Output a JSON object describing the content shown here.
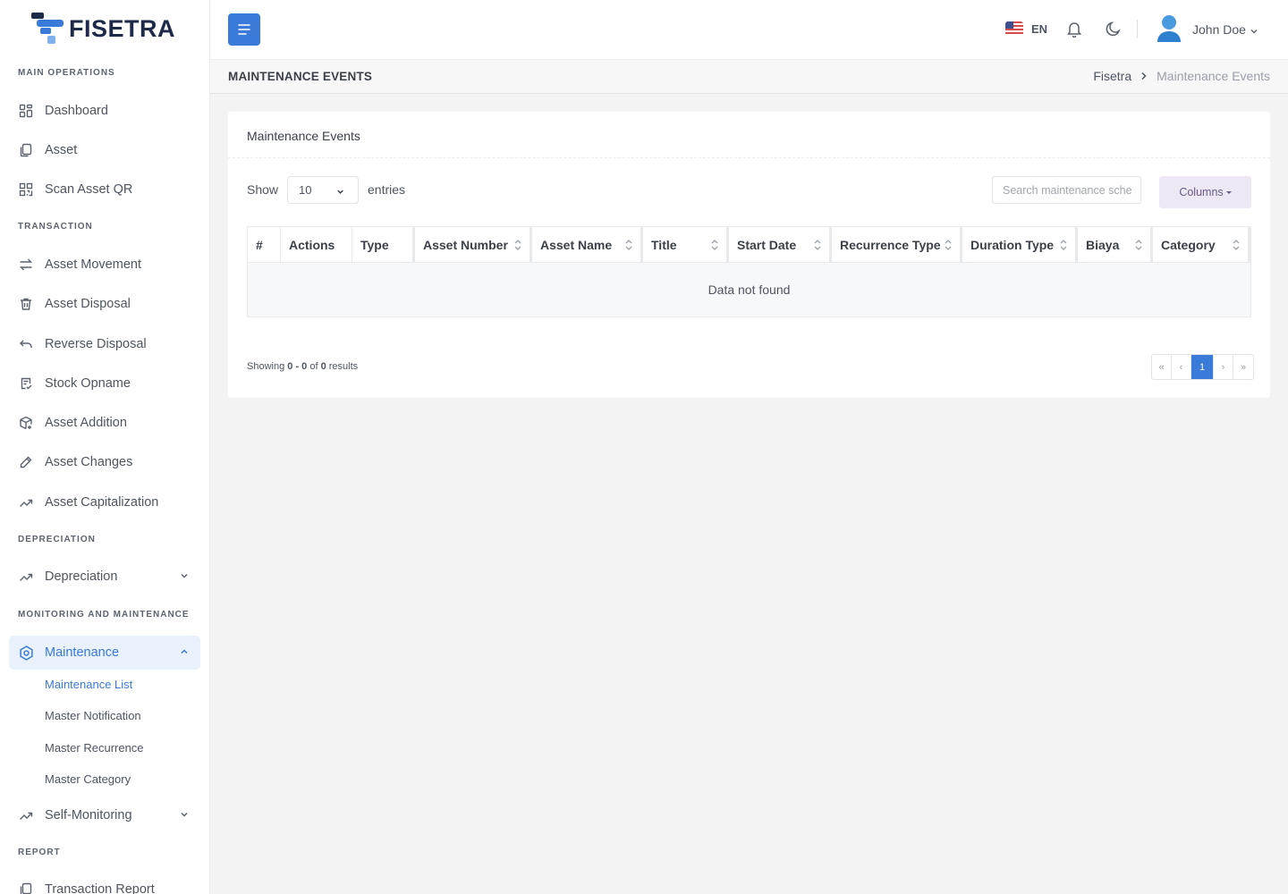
{
  "brand": {
    "name": "FISETRA"
  },
  "sidebar": {
    "sections": [
      {
        "title": "MAIN OPERATIONS"
      },
      {
        "title": "TRANSACTION"
      },
      {
        "title": "DEPRECIATION"
      },
      {
        "title": "MONITORING AND MAINTENANCE"
      },
      {
        "title": "REPORT"
      }
    ],
    "items": [
      {
        "label": "Dashboard",
        "icon": "dashboard-icon"
      },
      {
        "label": "Asset",
        "icon": "copy-icon"
      },
      {
        "label": "Scan Asset QR",
        "icon": "qr-icon"
      },
      {
        "label": "Asset Movement",
        "icon": "arrows-exchange-icon"
      },
      {
        "label": "Asset Disposal",
        "icon": "trash-icon"
      },
      {
        "label": "Reverse Disposal",
        "icon": "undo-icon"
      },
      {
        "label": "Stock Opname",
        "icon": "checklist-icon"
      },
      {
        "label": "Asset Addition",
        "icon": "box-plus-icon"
      },
      {
        "label": "Asset Changes",
        "icon": "pencil-icon"
      },
      {
        "label": "Asset Capitalization",
        "icon": "trending-up-icon"
      },
      {
        "label": "Depreciation",
        "icon": "trending-up-icon"
      },
      {
        "label": "Maintenance",
        "icon": "hexagon-gear-icon"
      },
      {
        "label": "Self-Monitoring",
        "icon": "trending-up-icon"
      },
      {
        "label": "Transaction Report",
        "icon": "copy-icon"
      }
    ],
    "maintenance_sub": [
      {
        "label": "Maintenance List"
      },
      {
        "label": "Master Notification"
      },
      {
        "label": "Master Recurrence"
      },
      {
        "label": "Master Category"
      }
    ]
  },
  "topbar": {
    "language": "EN",
    "user_name": "John Doe"
  },
  "page": {
    "title": "MAINTENANCE EVENTS",
    "breadcrumb": [
      "Fisetra",
      "Maintenance Events"
    ]
  },
  "card": {
    "title": "Maintenance Events",
    "show_label": "Show",
    "entries_value": "10",
    "entries_label": "entries",
    "search_placeholder": "Search maintenance sche",
    "columns_label": "Columns",
    "table": {
      "headers": [
        "#",
        "Actions",
        "Type",
        "Asset Number",
        "Asset Name",
        "Title",
        "Start Date",
        "Recurrence Type",
        "Duration Type",
        "Biaya",
        "Category"
      ],
      "empty_text": "Data not found"
    },
    "footer": {
      "showing_prefix": "Showing ",
      "range": "0 - 0",
      "of": " of ",
      "total": "0",
      "suffix": " results"
    },
    "pagination": {
      "first": "«",
      "prev": "‹",
      "current": "1",
      "next": "›",
      "last": "»"
    }
  },
  "colors": {
    "accent": "#3a7ad9",
    "columns_bg": "#ede8f3"
  }
}
